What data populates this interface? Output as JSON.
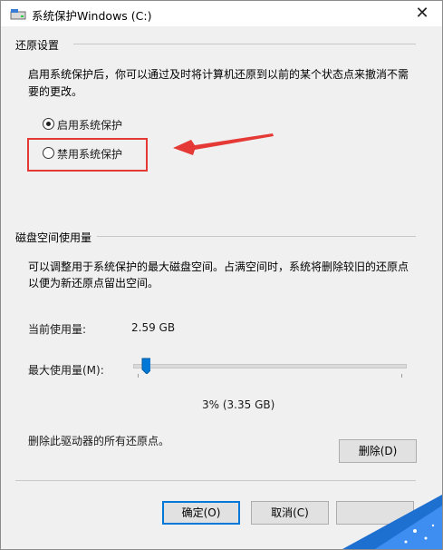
{
  "window": {
    "title": "系统保护Windows (C:)",
    "close_glyph": "✕"
  },
  "restore_settings": {
    "group_label": "还原设置",
    "description_line1": "启用系统保护后，你可以通过及时将计算机还原到以前的某个状态点来撤消不需",
    "description_line2": "要的更改。",
    "options": [
      {
        "label": "启用系统保护",
        "selected": true
      },
      {
        "label": "禁用系统保护",
        "selected": false
      }
    ]
  },
  "disk_usage": {
    "group_label": "磁盘空间使用量",
    "description_line1": "可以调整用于系统保护的最大磁盘空间。占满空间时，系统将删除较旧的还原点",
    "description_line2": "以便为新还原点留出空间。",
    "current_label": "当前使用量:",
    "current_value": "2.59 GB",
    "max_label": "最大使用量(M):",
    "slider_percent": 3,
    "slider_readout": "3% (3.35 GB)",
    "delete_text": "删除此驱动器的所有还原点。",
    "delete_button": "删除(D)"
  },
  "footer": {
    "ok_button": "确定(O)",
    "cancel_button": "取消(C)"
  },
  "colors": {
    "accent": "#0078d7",
    "annotation": "#e53935"
  }
}
